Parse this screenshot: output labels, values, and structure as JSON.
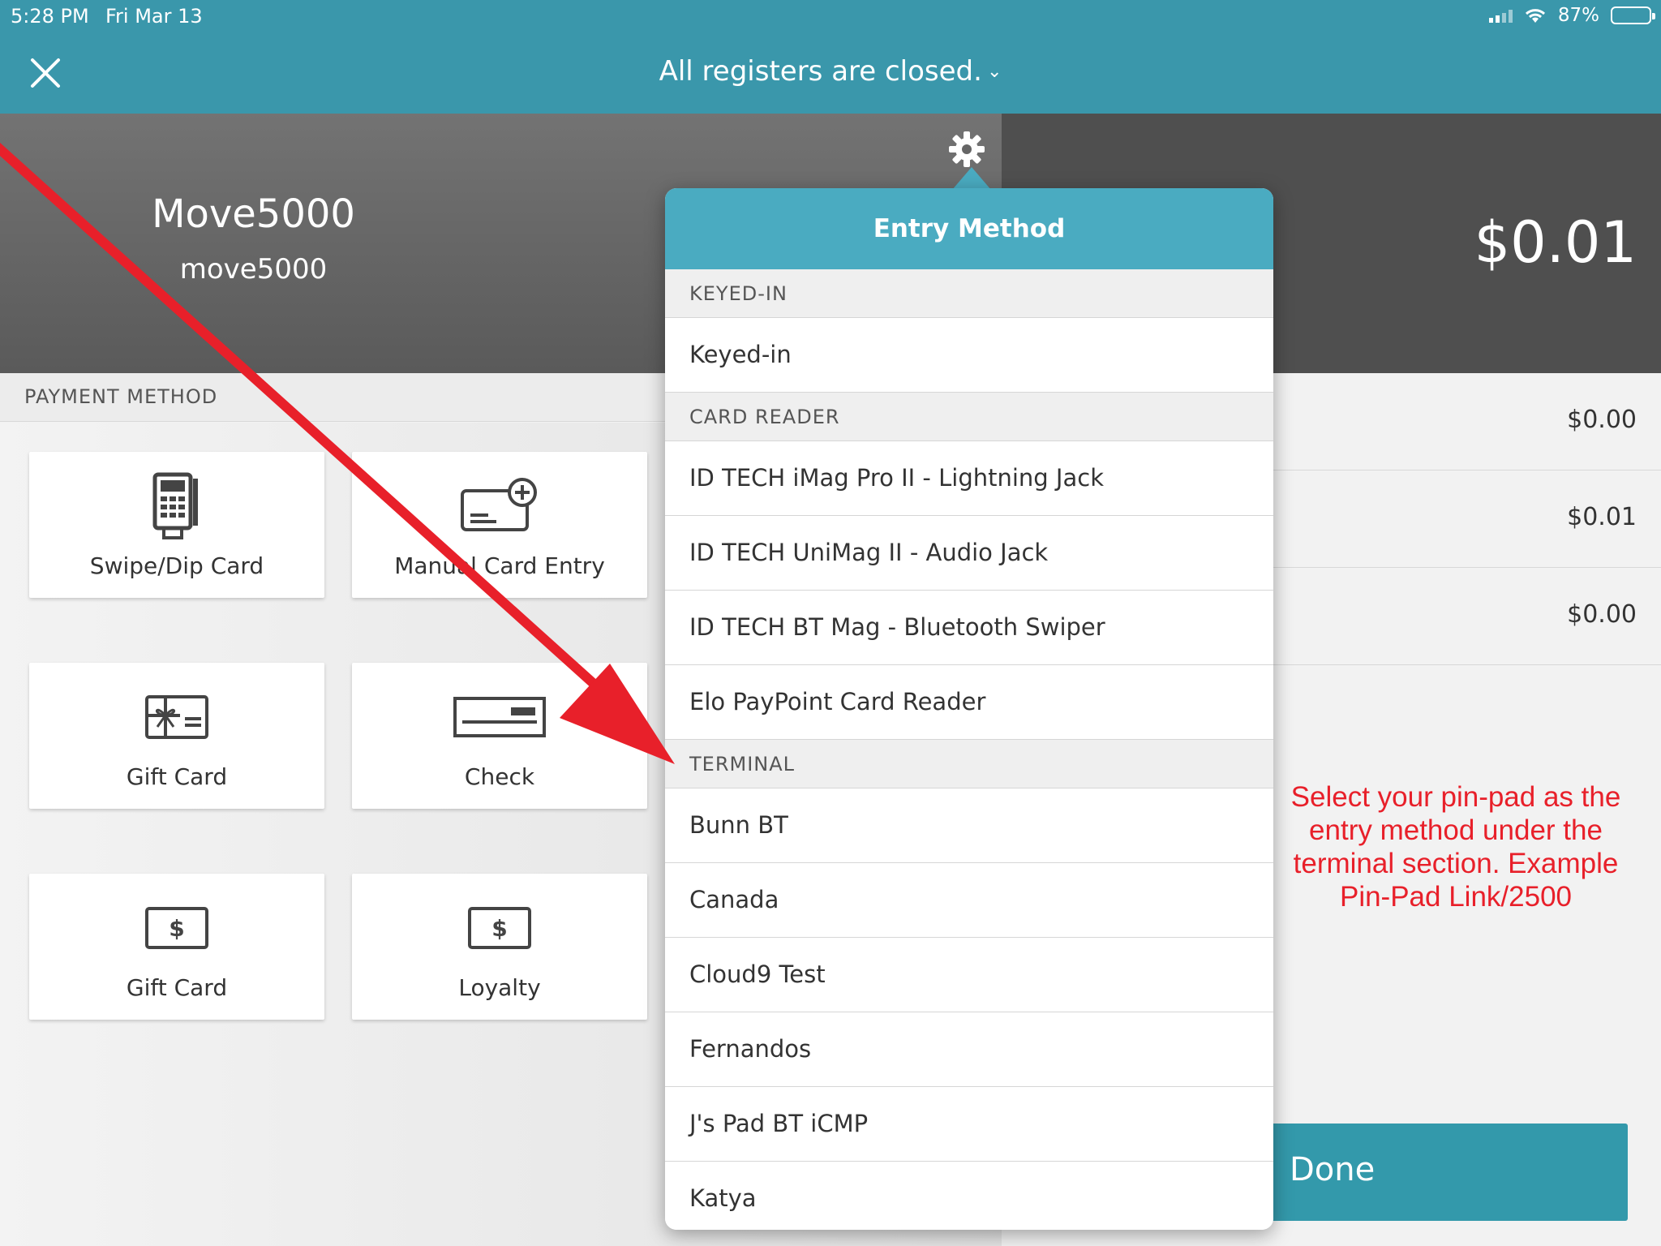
{
  "status_bar": {
    "time": "5:28 PM",
    "date": "Fri Mar 13",
    "battery": "87%",
    "battery_level": 0.87
  },
  "nav": {
    "title": "All registers are closed."
  },
  "header": {
    "merchant_name": "Move5000",
    "merchant_id": "move5000",
    "total": "$0.01"
  },
  "payment_method": {
    "heading": "PAYMENT METHOD",
    "tiles": [
      {
        "label": "Swipe/Dip Card",
        "icon": "card-terminal-icon"
      },
      {
        "label": "Manual Card Entry",
        "icon": "card-add-icon"
      },
      {
        "label": "Gift Card",
        "icon": "gift-card-icon"
      },
      {
        "label": "Check",
        "icon": "check-icon"
      },
      {
        "label": "Gift Card",
        "icon": "dollar-card-icon"
      },
      {
        "label": "Loyalty",
        "icon": "dollar-card-icon"
      }
    ]
  },
  "summary": {
    "rows": [
      "$0.00",
      "$0.01",
      "$0.00"
    ],
    "done_label": "Done"
  },
  "popover": {
    "title": "Entry Method",
    "sections": [
      {
        "heading": "KEYED-IN",
        "options": [
          "Keyed-in"
        ]
      },
      {
        "heading": "CARD READER",
        "options": [
          "ID TECH iMag Pro II - Lightning Jack",
          "ID TECH UniMag II - Audio Jack",
          "ID TECH BT Mag - Bluetooth Swiper",
          "Elo PayPoint Card Reader"
        ]
      },
      {
        "heading": "TERMINAL",
        "options": [
          "Bunn BT",
          "Canada",
          "Cloud9 Test",
          "Fernandos",
          "J's Pad BT iCMP",
          "Katya"
        ]
      }
    ]
  },
  "annotation": "Select your pin-pad as the entry method under the terminal section. Example Pin-Pad Link/2500",
  "colors": {
    "teal": "#3a97ab",
    "popover_header": "#4aabc1",
    "annotation_red": "#e8202a"
  }
}
